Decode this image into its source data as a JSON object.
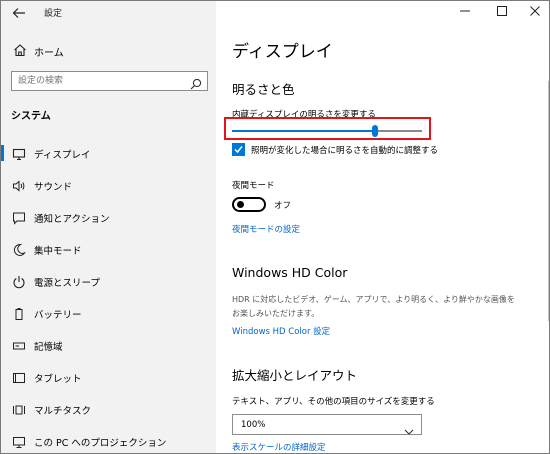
{
  "window": {
    "app_title": "設定",
    "back_icon": "back-arrow-icon",
    "minimize_icon": "minimize-icon",
    "maximize_icon": "maximize-icon",
    "close_icon": "close-icon"
  },
  "sidebar": {
    "home_label": "ホーム",
    "search_placeholder": "設定の検索",
    "section_title": "システム",
    "items": [
      {
        "label": "ディスプレイ",
        "icon": "display-icon",
        "selected": true
      },
      {
        "label": "サウンド",
        "icon": "speaker-icon",
        "selected": false
      },
      {
        "label": "通知とアクション",
        "icon": "notification-icon",
        "selected": false
      },
      {
        "label": "集中モード",
        "icon": "moon-icon",
        "selected": false
      },
      {
        "label": "電源とスリープ",
        "icon": "power-icon",
        "selected": false
      },
      {
        "label": "バッテリー",
        "icon": "battery-icon",
        "selected": false
      },
      {
        "label": "記憶域",
        "icon": "storage-icon",
        "selected": false
      },
      {
        "label": "タブレット",
        "icon": "tablet-icon",
        "selected": false
      },
      {
        "label": "マルチタスク",
        "icon": "multitask-icon",
        "selected": false
      },
      {
        "label": "この PC へのプロジェクション",
        "icon": "projection-icon",
        "selected": false
      }
    ]
  },
  "main": {
    "page_title": "ディスプレイ",
    "brightness": {
      "heading": "明るさと色",
      "slider_label": "内蔵ディスプレイの明るさを変更する",
      "slider_value_fraction": 0.75,
      "auto_brightness_label": "照明が変化した場合に明るさを自動的に調整する",
      "auto_brightness_checked": true
    },
    "night_mode": {
      "label": "夜間モード",
      "state_label": "オフ",
      "settings_link": "夜間モードの設定"
    },
    "hdr": {
      "heading": "Windows HD Color",
      "description": "HDR に対応したビデオ、ゲーム、アプリで、より明るく、より鮮やかな画像をお楽しみいただけます。",
      "settings_link": "Windows HD Color 設定"
    },
    "scale": {
      "heading": "拡大縮小とレイアウト",
      "label": "テキスト、アプリ、その他の項目のサイズを変更する",
      "selected_value": "100%",
      "advanced_link": "表示スケールの詳細設定"
    }
  },
  "colors": {
    "accent": "#0078d7",
    "link": "#0066cc",
    "highlight": "#e1141c",
    "sidebar_bg": "#f2f2f2"
  }
}
